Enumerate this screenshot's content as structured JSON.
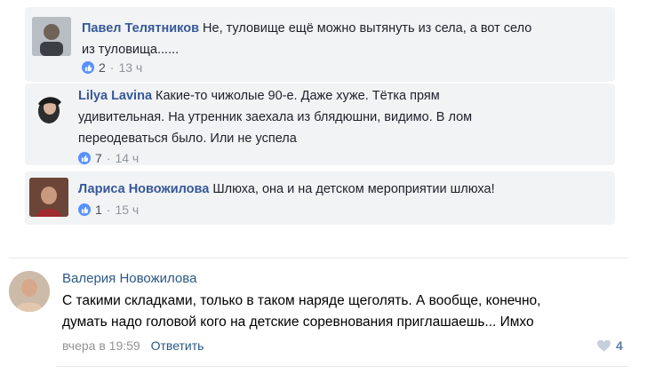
{
  "comments": [
    {
      "author": "Павел Телятников",
      "text_line1": "Не, туловище ещё можно вытянуть из села, а вот село",
      "text_line2": "из туловища......",
      "likes": "2",
      "time": "13 ч"
    },
    {
      "author": "Lilya Lavina",
      "text_line1": "Какие-то чижолые 90-е. Даже хуже. Тётка прям",
      "text_line2": "удивительная. На утренник заехала из блядюшни, видимо. В лом",
      "text_line3": "переодеваться было. Или не успела",
      "likes": "7",
      "time": "14 ч"
    },
    {
      "author": "Лариса Новожилова",
      "text_line1": "Шлюха, она и на детском мероприятии шлюха!",
      "likes": "1",
      "time": "15 ч"
    }
  ],
  "vk_comment": {
    "author": "Валерия Новожилова",
    "text_line1": "С такими складками, только в таком наряде щеголять. А вообще, конечно,",
    "text_line2": "думать надо головой кого на детские соревнования приглашаешь... Имхо",
    "time": "вчера в 19:59",
    "reply_label": "Ответить",
    "likes": "4"
  },
  "colors": {
    "fb_bubble": "#f2f3f5",
    "fb_link": "#365899",
    "fb_like": "#5890ff",
    "vk_link": "#2a5885"
  }
}
